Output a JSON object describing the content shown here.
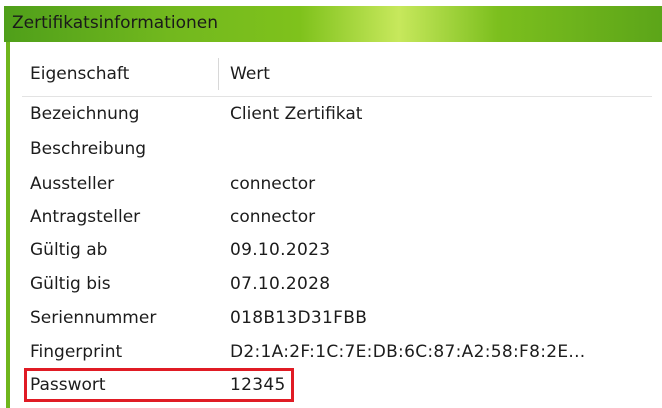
{
  "panel": {
    "title": "Zertifikatsinformationen",
    "accent_color": "#6fb61c",
    "highlight_color": "#e01b24"
  },
  "table": {
    "headers": {
      "property": "Eigenschaft",
      "value": "Wert"
    },
    "rows": [
      {
        "property": "Bezeichnung",
        "value": "Client Zertifikat"
      },
      {
        "property": "Beschreibung",
        "value": ""
      },
      {
        "property": "Aussteller",
        "value": "connector"
      },
      {
        "property": "Antragsteller",
        "value": "connector"
      },
      {
        "property": "Gültig ab",
        "value": "09.10.2023"
      },
      {
        "property": "Gültig bis",
        "value": "07.10.2028"
      },
      {
        "property": "Seriennummer",
        "value": "018B13D31FBB"
      },
      {
        "property": "Fingerprint",
        "value": "D2:1A:2F:1C:7E:DB:6C:87:A2:58:F8:2E..."
      },
      {
        "property": "Passwort",
        "value": "12345"
      }
    ]
  }
}
